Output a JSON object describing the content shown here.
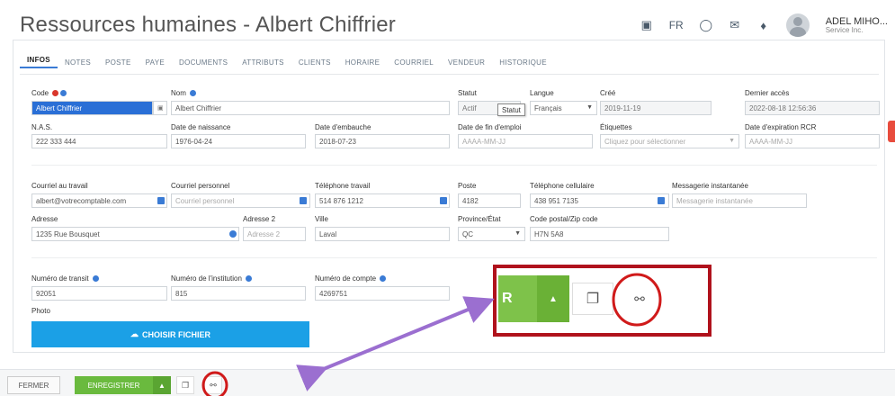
{
  "header": {
    "title": "Ressources humaines - Albert Chiffrier",
    "lang": "FR",
    "user_name": "ADEL MIHO...",
    "user_sub": "Service Inc."
  },
  "tabs": [
    "INFOS",
    "NOTES",
    "POSTE",
    "PAYE",
    "DOCUMENTS",
    "ATTRIBUTS",
    "CLIENTS",
    "HORAIRE",
    "COURRIEL",
    "VENDEUR",
    "HISTORIQUE"
  ],
  "form": {
    "code": {
      "label": "Code",
      "value": "Albert Chiffrier"
    },
    "nom": {
      "label": "Nom",
      "value": "Albert Chiffrier"
    },
    "statut": {
      "label": "Statut",
      "value": "Actif"
    },
    "langue": {
      "label": "Langue",
      "value": "Français"
    },
    "cree": {
      "label": "Créé",
      "value": "2019-11-19"
    },
    "dernier_acces": {
      "label": "Dernier accès",
      "value": "2022-08-18 12:56:36"
    },
    "nas": {
      "label": "N.A.S.",
      "value": "222 333 444"
    },
    "date_naissance": {
      "label": "Date de naissance",
      "value": "1976-04-24"
    },
    "date_embauche": {
      "label": "Date d'embauche",
      "value": "2018-07-23"
    },
    "date_fin": {
      "label": "Date de fin d'emploi",
      "placeholder": "AAAA-MM-JJ"
    },
    "etiquettes": {
      "label": "Étiquettes",
      "placeholder": "Cliquez pour sélectionner"
    },
    "date_rcr": {
      "label": "Date d'expiration RCR",
      "placeholder": "AAAA-MM-JJ"
    },
    "courriel_travail": {
      "label": "Courriel au travail",
      "value": "albert@votrecomptable.com"
    },
    "courriel_perso": {
      "label": "Courriel personnel",
      "placeholder": "Courriel personnel"
    },
    "tel_travail": {
      "label": "Téléphone travail",
      "value": "514 876 1212"
    },
    "poste": {
      "label": "Poste",
      "value": "4182"
    },
    "tel_cell": {
      "label": "Téléphone cellulaire",
      "value": "438 951 7135"
    },
    "messagerie": {
      "label": "Messagerie instantanée",
      "placeholder": "Messagerie instantanée"
    },
    "adresse": {
      "label": "Adresse",
      "value": "1235 Rue Bousquet"
    },
    "adresse2": {
      "label": "Adresse 2",
      "placeholder": "Adresse 2"
    },
    "ville": {
      "label": "Ville",
      "value": "Laval"
    },
    "province": {
      "label": "Province/État",
      "value": "QC"
    },
    "code_postal": {
      "label": "Code postal/Zip code",
      "value": "H7N 5A8"
    },
    "transit": {
      "label": "Numéro de transit",
      "value": "92051"
    },
    "institution": {
      "label": "Numéro de l'institution",
      "value": "815"
    },
    "compte": {
      "label": "Numéro de compte",
      "value": "4269751"
    },
    "photo": {
      "label": "Photo"
    }
  },
  "choose_file_label": "CHOISIR FICHIER",
  "tooltip": "Statut",
  "bottombar": {
    "close_label": "FERMER",
    "save_label": "ENREGISTRER"
  },
  "zoom": {
    "save_fragment": "R"
  },
  "colors": {
    "accent": "#3a7bd5",
    "save_green": "#6aba3e",
    "choose_blue": "#1ba0e6",
    "callout_red": "#b0121c",
    "arrow_purple": "#9b6fd0"
  }
}
